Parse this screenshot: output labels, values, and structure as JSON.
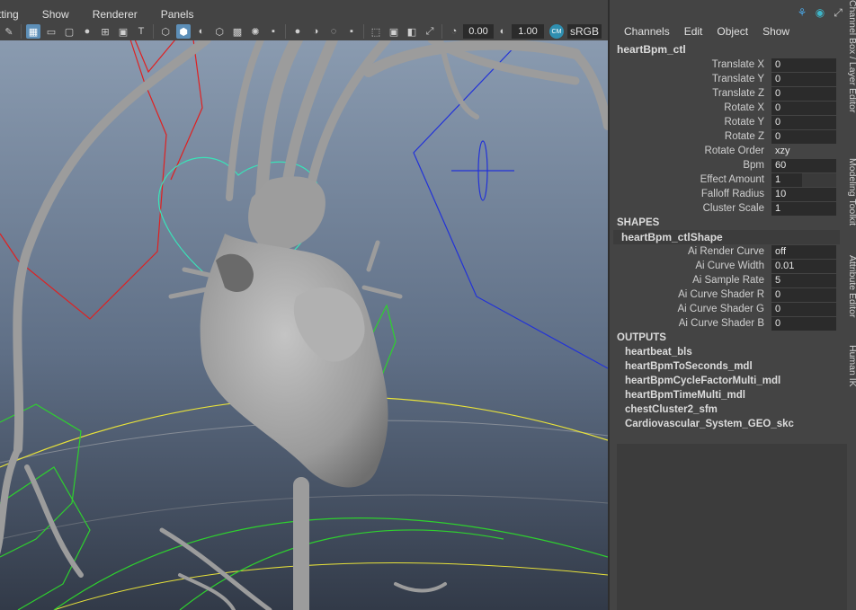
{
  "viewport": {
    "menus": [
      "tting",
      "Show",
      "Renderer",
      "Panels"
    ],
    "toolbar": {
      "exposure_value": "0.00",
      "gamma_value": "1.00",
      "color_management_badge": "CM",
      "color_space": "sRGB"
    }
  },
  "channel_box": {
    "menus": [
      "Channels",
      "Edit",
      "Object",
      "Show"
    ],
    "node_name": "heartBpm_ctl",
    "attributes": [
      {
        "label": "Translate X",
        "value": "0"
      },
      {
        "label": "Translate Y",
        "value": "0"
      },
      {
        "label": "Translate Z",
        "value": "0"
      },
      {
        "label": "Rotate X",
        "value": "0"
      },
      {
        "label": "Rotate Y",
        "value": "0"
      },
      {
        "label": "Rotate Z",
        "value": "0"
      },
      {
        "label": "Rotate Order",
        "value": "xzy"
      },
      {
        "label": "Bpm",
        "value": "60"
      },
      {
        "label": "Effect Amount",
        "value": "1"
      },
      {
        "label": "Falloff Radius",
        "value": "10"
      },
      {
        "label": "Cluster Scale",
        "value": "1"
      }
    ],
    "shapes_header": "SHAPES",
    "shape_name": "heartBpm_ctlShape",
    "shape_attributes": [
      {
        "label": "Ai Render Curve",
        "value": "off"
      },
      {
        "label": "Ai Curve Width",
        "value": "0.01"
      },
      {
        "label": "Ai Sample Rate",
        "value": "5"
      },
      {
        "label": "Ai Curve Shader R",
        "value": "0"
      },
      {
        "label": "Ai Curve Shader G",
        "value": "0"
      },
      {
        "label": "Ai Curve Shader B",
        "value": "0"
      }
    ],
    "outputs_header": "OUTPUTS",
    "outputs": [
      "heartbeat_bls",
      "heartBpmToSeconds_mdl",
      "heartBpmCycleFactorMulti_mdl",
      "heartBpmTimeMulti_mdl",
      "chestCluster2_sfm",
      "Cardiovascular_System_GEO_skc"
    ]
  },
  "side_tabs": [
    "Channel Box / Layer Editor",
    "Modeling Toolkit",
    "Attribute Editor",
    "Human IK"
  ]
}
